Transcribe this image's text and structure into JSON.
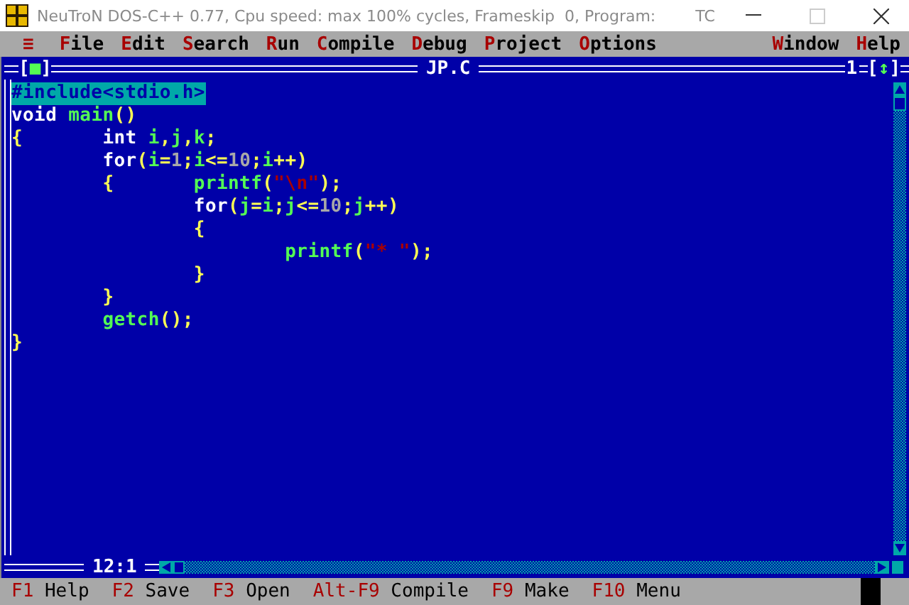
{
  "window": {
    "title": "NeuTroN DOS-C++ 0.77, Cpu speed: max 100% cycles, Frameskip  0, Program:",
    "program": "TC"
  },
  "menu": {
    "system": "≡",
    "items": [
      {
        "label": "File"
      },
      {
        "label": "Edit"
      },
      {
        "label": "Search"
      },
      {
        "label": "Run"
      },
      {
        "label": "Compile"
      },
      {
        "label": "Debug"
      },
      {
        "label": "Project"
      },
      {
        "label": "Options"
      },
      {
        "label": "Window",
        "kind": "right"
      },
      {
        "label": "Help",
        "kind": "right"
      }
    ]
  },
  "editor": {
    "title": "JP.C",
    "close_box": "[■]",
    "window_number": "1",
    "zoom_box": "[↕]",
    "position": "12:1",
    "lines": [
      {
        "selected": true,
        "tokens": [
          {
            "kind": "directive",
            "text": "#include<stdio.h>"
          }
        ]
      },
      {
        "selected": false,
        "tokens": [
          {
            "kind": "keyword",
            "text": "void"
          },
          {
            "kind": "ident",
            "text": " main"
          },
          {
            "kind": "punct",
            "text": "()"
          }
        ]
      },
      {
        "selected": false,
        "tokens": [
          {
            "kind": "punct",
            "text": "{"
          },
          {
            "kind": "keyword",
            "text": "       int"
          },
          {
            "kind": "ident",
            "text": " i"
          },
          {
            "kind": "punct",
            "text": ","
          },
          {
            "kind": "ident",
            "text": "j"
          },
          {
            "kind": "punct",
            "text": ","
          },
          {
            "kind": "ident",
            "text": "k"
          },
          {
            "kind": "punct",
            "text": ";"
          }
        ]
      },
      {
        "selected": false,
        "tokens": [
          {
            "kind": "keyword",
            "text": "        for"
          },
          {
            "kind": "punct",
            "text": "("
          },
          {
            "kind": "ident",
            "text": "i"
          },
          {
            "kind": "punct",
            "text": "="
          },
          {
            "kind": "number",
            "text": "1"
          },
          {
            "kind": "punct",
            "text": ";"
          },
          {
            "kind": "ident",
            "text": "i"
          },
          {
            "kind": "punct",
            "text": "<="
          },
          {
            "kind": "number",
            "text": "10"
          },
          {
            "kind": "punct",
            "text": ";"
          },
          {
            "kind": "ident",
            "text": "i"
          },
          {
            "kind": "punct",
            "text": "++)"
          }
        ]
      },
      {
        "selected": false,
        "tokens": [
          {
            "kind": "punct",
            "text": "        {"
          },
          {
            "kind": "ident",
            "text": "       printf"
          },
          {
            "kind": "punct",
            "text": "("
          },
          {
            "kind": "string",
            "text": "\"\\n\""
          },
          {
            "kind": "punct",
            "text": ");"
          }
        ]
      },
      {
        "selected": false,
        "tokens": [
          {
            "kind": "keyword",
            "text": "                for"
          },
          {
            "kind": "punct",
            "text": "("
          },
          {
            "kind": "ident",
            "text": "j"
          },
          {
            "kind": "punct",
            "text": "="
          },
          {
            "kind": "ident",
            "text": "i"
          },
          {
            "kind": "punct",
            "text": ";"
          },
          {
            "kind": "ident",
            "text": "j"
          },
          {
            "kind": "punct",
            "text": "<="
          },
          {
            "kind": "number",
            "text": "10"
          },
          {
            "kind": "punct",
            "text": ";"
          },
          {
            "kind": "ident",
            "text": "j"
          },
          {
            "kind": "punct",
            "text": "++)"
          }
        ]
      },
      {
        "selected": false,
        "tokens": [
          {
            "kind": "punct",
            "text": "                {"
          }
        ]
      },
      {
        "selected": false,
        "tokens": [
          {
            "kind": "ident",
            "text": "                        printf"
          },
          {
            "kind": "punct",
            "text": "("
          },
          {
            "kind": "string",
            "text": "\"* \""
          },
          {
            "kind": "punct",
            "text": ");"
          }
        ]
      },
      {
        "selected": false,
        "tokens": [
          {
            "kind": "punct",
            "text": "                }"
          }
        ]
      },
      {
        "selected": false,
        "tokens": [
          {
            "kind": "punct",
            "text": "        }"
          }
        ]
      },
      {
        "selected": false,
        "tokens": [
          {
            "kind": "ident",
            "text": "        getch"
          },
          {
            "kind": "punct",
            "text": "();"
          }
        ]
      },
      {
        "selected": false,
        "tokens": [
          {
            "kind": "punct",
            "text": "}"
          }
        ]
      }
    ]
  },
  "status_bar": [
    {
      "key": "F1",
      "label": "Help"
    },
    {
      "key": "F2",
      "label": "Save"
    },
    {
      "key": "F3",
      "label": "Open"
    },
    {
      "key": "Alt-F9",
      "label": "Compile"
    },
    {
      "key": "F9",
      "label": "Make"
    },
    {
      "key": "F10",
      "label": "Menu"
    }
  ]
}
